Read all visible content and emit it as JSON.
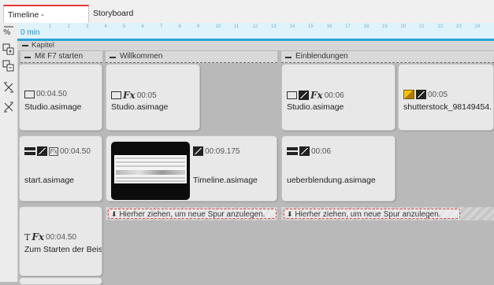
{
  "tabs": [
    {
      "label": "Timeline - Spuransicht",
      "active": true
    },
    {
      "label": "Storyboard",
      "active": false
    }
  ],
  "ruler": {
    "label": "0 min",
    "ticks": [
      "1",
      "2",
      "3",
      "4",
      "5",
      "6",
      "7",
      "8",
      "9",
      "10",
      "11",
      "12",
      "13",
      "14",
      "15",
      "16",
      "17",
      "18",
      "19",
      "20",
      "21",
      "22",
      "23",
      "24"
    ]
  },
  "kapitel_label": "Kapitel",
  "chapters": [
    {
      "label": "Mit F7 starten"
    },
    {
      "label": "Willkommen"
    },
    {
      "label": "Einblendungen"
    }
  ],
  "clips": [
    {
      "duration": "00:04.50",
      "name": "Studio.asimage"
    },
    {
      "duration": "00:05",
      "name": "Studio.asimage"
    },
    {
      "duration": "00:06",
      "name": "Studio.asimage"
    },
    {
      "duration": "00:05",
      "name": "shutterstock_98149454."
    },
    {
      "duration": "00:04.50",
      "name": "start.asimage"
    },
    {
      "duration": "00:09.175",
      "name": "Timeline.asimage"
    },
    {
      "duration": "00:06",
      "name": "ueberblendung.asimage"
    },
    {
      "duration": "00:04.50",
      "name": "Zum Starten der Beis"
    }
  ],
  "drop_hint": "Hierher ziehen, um neue Spur anzulegen.",
  "colors": {
    "accent": "#2aa3d6",
    "tab_active": "#e23a3a",
    "drop_border": "#e04848"
  },
  "icons": [
    "zoom-icon",
    "expand-tracks-icon",
    "collapse-tracks-icon",
    "fit-icon",
    "trim-icon"
  ]
}
